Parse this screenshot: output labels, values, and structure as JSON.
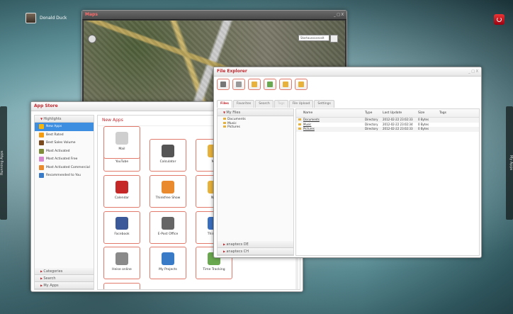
{
  "desktop": {
    "user_name": "Donald Duck",
    "left_tab": "Running Apps",
    "right_tab": "My Apps"
  },
  "maps": {
    "title": "Maps",
    "controls": "_ □ X",
    "search_placeholder": "Startausscanvolt"
  },
  "appstore": {
    "title": "App Store",
    "highlights_label": "Highlights",
    "highlights": [
      {
        "label": "New Apps",
        "icon": "star-icon",
        "color": "#f5b50a",
        "selected": true
      },
      {
        "label": "Best Rated",
        "icon": "star-icon",
        "color": "#f39c12",
        "selected": false
      },
      {
        "label": "Best Sales Volume",
        "icon": "book-icon",
        "color": "#7a4a1e",
        "selected": false
      },
      {
        "label": "Most Activated",
        "icon": "puzzle-icon",
        "color": "#7f8c3a",
        "selected": false
      },
      {
        "label": "Most Activated Free",
        "icon": "brain-icon",
        "color": "#d88ad0",
        "selected": false
      },
      {
        "label": "Most Activated Commercial",
        "icon": "bag-icon",
        "color": "#e88a2d",
        "selected": false
      },
      {
        "label": "Recommended to You",
        "icon": "globe-icon",
        "color": "#3a7bc8",
        "selected": false
      }
    ],
    "bottom_sections": [
      "Categories",
      "Search",
      "My Apps"
    ],
    "panel_title": "New Apps",
    "apps": [
      {
        "label": "YouTube",
        "color": "#c62828"
      },
      {
        "label": "Calculator",
        "color": "#555555"
      },
      {
        "label": "Ma",
        "color": "#e8b23a"
      },
      {
        "label": "Calendar",
        "color": "#c62828"
      },
      {
        "label": "Thinkfree Show",
        "color": "#e88a2d"
      },
      {
        "label": "Not",
        "color": "#e8b23a"
      },
      {
        "label": "Facebook",
        "color": "#3b5998"
      },
      {
        "label": "E-Post Office",
        "color": "#666666"
      },
      {
        "label": "Thinkfre",
        "color": "#3a6fbf"
      },
      {
        "label": "Heise online",
        "color": "#8a8a8a"
      },
      {
        "label": "My Projects",
        "color": "#3a7bc8"
      },
      {
        "label": "Time Tracking",
        "color": "#6aa84f"
      },
      {
        "label": "Mail",
        "color": "#cfcfcf"
      }
    ]
  },
  "file_explorer": {
    "title": "File Explorer",
    "controls": "_ □ X",
    "toolbar_icons": [
      "tools-icon",
      "document-icon",
      "clipboard-icon",
      "upload-icon",
      "folder-upload-icon",
      "folders-icon"
    ],
    "tabs": [
      {
        "label": "Files",
        "active": true,
        "disabled": false
      },
      {
        "label": "Favorites",
        "active": false,
        "disabled": false
      },
      {
        "label": "Search",
        "active": false,
        "disabled": false
      },
      {
        "label": "Tags",
        "active": false,
        "disabled": true
      },
      {
        "label": "File Upload",
        "active": false,
        "disabled": false
      },
      {
        "label": "Settings",
        "active": false,
        "disabled": false
      }
    ],
    "tree_root": "My Files",
    "tree": [
      "Documents",
      "Music",
      "Pictures"
    ],
    "left_bottom": [
      "anaptecs DE",
      "anaptecs CH"
    ],
    "columns": [
      "Name",
      "Type",
      "Last Update",
      "Size",
      "Tags"
    ],
    "rows": [
      {
        "name": "Documents",
        "type": "Directory",
        "updated": "2012-02-22 23:02:33",
        "size": "0 Bytes",
        "tags": ""
      },
      {
        "name": "Music",
        "type": "Directory",
        "updated": "2012-02-22 23:02:34",
        "size": "0 Bytes",
        "tags": ""
      },
      {
        "name": "Pictures",
        "type": "Directory",
        "updated": "2012-02-22 23:02:33",
        "size": "0 Bytes",
        "tags": ""
      }
    ]
  }
}
